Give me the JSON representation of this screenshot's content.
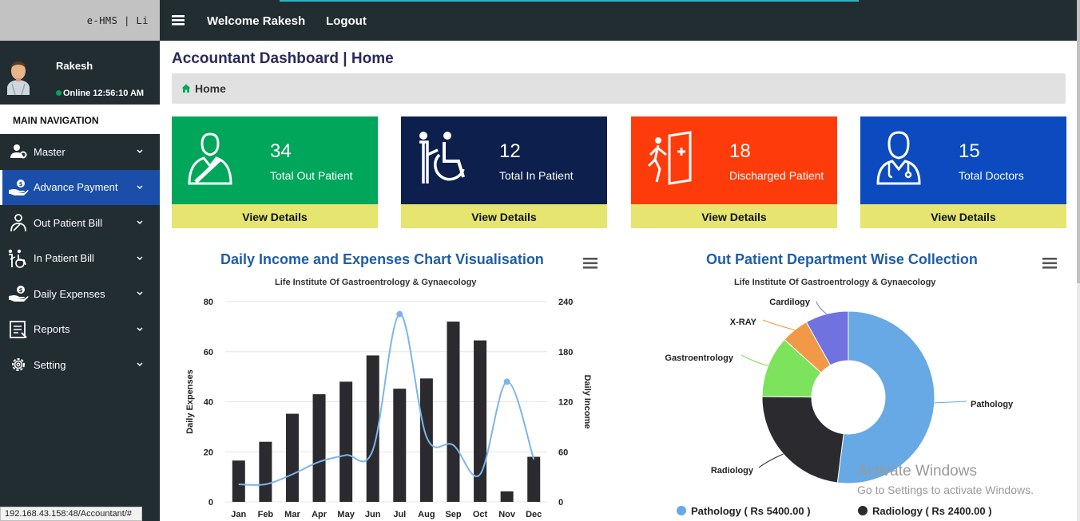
{
  "brand": {
    "text": "e-HMS | Li"
  },
  "user": {
    "name": "Rakesh",
    "status": "Online 12:56:10 AM"
  },
  "nav": {
    "header": "MAIN NAVIGATION",
    "items": [
      {
        "label": "Master",
        "icon": "settings-people-icon"
      },
      {
        "label": "Advance Payment",
        "icon": "money-hand-icon"
      },
      {
        "label": "Out Patient Bill",
        "icon": "outpatient-icon"
      },
      {
        "label": "In Patient Bill",
        "icon": "wheelchair-icon"
      },
      {
        "label": "Daily Expenses",
        "icon": "money-hand-icon"
      },
      {
        "label": "Reports",
        "icon": "report-icon"
      },
      {
        "label": "Setting",
        "icon": "gear-icon"
      }
    ]
  },
  "topbar": {
    "welcome": "Welcome Rakesh",
    "logout": "Logout"
  },
  "page": {
    "title": "Accountant Dashboard | Home",
    "breadcrumb": "Home"
  },
  "stats": [
    {
      "count": "34",
      "label": "Total Out Patient",
      "link": "View Details",
      "color": "#00a65a"
    },
    {
      "count": "12",
      "label": "Total In Patient",
      "link": "View Details",
      "color": "#0d1f4c"
    },
    {
      "count": "18",
      "label": "Discharged Patient",
      "link": "View Details",
      "color": "#fe3b0a"
    },
    {
      "count": "15",
      "label": "Total Doctors",
      "link": "View Details",
      "color": "#0b4bbf"
    }
  ],
  "url": "192.168.43.158:48/Accountant/#",
  "watermark": {
    "line1": "Activate Windows",
    "line2": "Go to Settings to activate Windows."
  },
  "chart_data": [
    {
      "type": "bar",
      "title": "Daily Income and Expenses Chart Visualisation",
      "subtitle": "Life Institute Of Gastroentrology & Gynaecology",
      "categories": [
        "Jan",
        "Feb",
        "Mar",
        "Apr",
        "May",
        "Jun",
        "Jul",
        "Aug",
        "Sep",
        "Oct",
        "Nov",
        "Dec"
      ],
      "ylabel": "Daily Expenses",
      "y2label": "Daily Income",
      "ylim": [
        0,
        80
      ],
      "y2lim": [
        0,
        240
      ],
      "yticks": [
        "0",
        "20",
        "40",
        "60",
        "80"
      ],
      "y2ticks": [
        "0",
        "60",
        "120",
        "180",
        "240"
      ],
      "series": [
        {
          "type": "bar",
          "axis": "left",
          "color": "#2b2b2f",
          "values": [
            16.5,
            24,
            35.2,
            43,
            48,
            58.5,
            45.2,
            49.3,
            72,
            64.5,
            4.2,
            18
          ]
        },
        {
          "type": "spline",
          "axis": "right",
          "color": "#7cb5ec",
          "values": [
            21,
            21,
            33,
            48,
            56,
            62,
            225,
            78,
            68,
            33,
            144,
            51
          ]
        }
      ],
      "grid": true
    },
    {
      "type": "pie",
      "title": "Out Patient Department Wise Collection",
      "subtitle": "Life Institute Of Gastroentrology & Gynaecology",
      "slices": [
        {
          "label": "Pathology",
          "value": 5400,
          "color": "#67a9e5"
        },
        {
          "label": "Radiology",
          "value": 2400,
          "color": "#2b2b2f"
        },
        {
          "label": "Gastroentrology",
          "value": 1200,
          "color": "#7de25c"
        },
        {
          "label": "X-RAY",
          "value": 540,
          "color": "#f19947"
        },
        {
          "label": "Cardilogy",
          "value": 840,
          "color": "#7072e0"
        }
      ],
      "legend": [
        "Pathology ( Rs 5400.00 )",
        "Radiology ( Rs 2400.00 )"
      ]
    }
  ]
}
